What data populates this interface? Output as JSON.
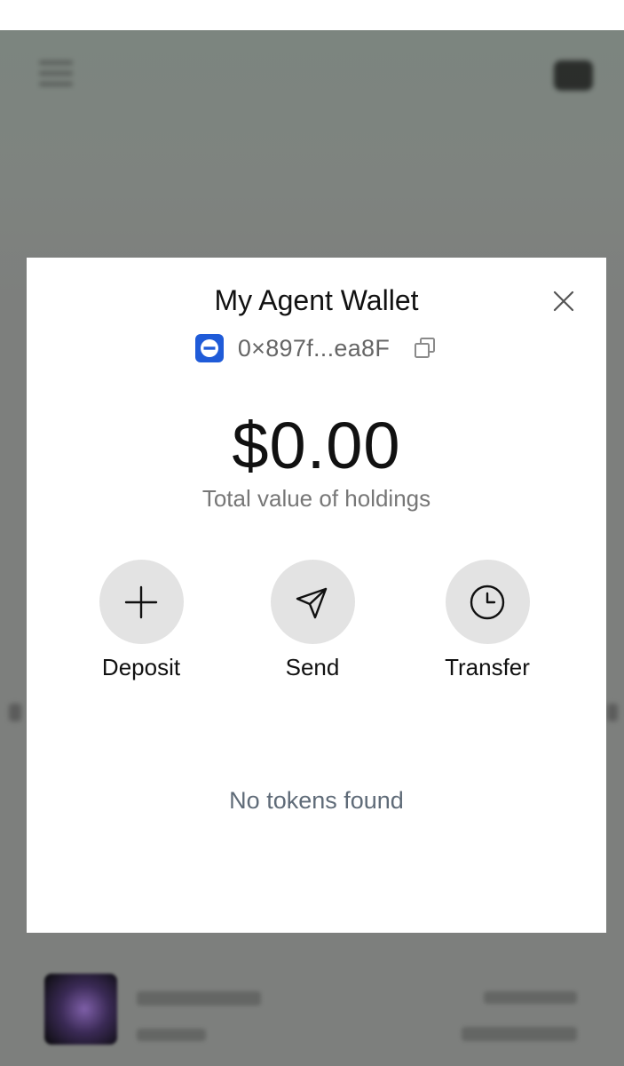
{
  "wallet_modal": {
    "title": "My Agent Wallet",
    "address": "0×897f...ea8F",
    "balance": "$0.00",
    "balance_label": "Total value of holdings",
    "actions": [
      {
        "label": "Deposit",
        "icon": "plus-icon"
      },
      {
        "label": "Send",
        "icon": "send-icon"
      },
      {
        "label": "Transfer",
        "icon": "clock-icon"
      }
    ],
    "empty_state": "No tokens found",
    "icons": {
      "close": "close-icon",
      "copy": "copy-icon",
      "chain": "chain-logo-icon"
    }
  },
  "colors": {
    "overlay_background": "#7d7f7d",
    "modal_background": "#ffffff",
    "action_circle": "#e3e3e3",
    "chain_blue": "#1f5bd8",
    "muted_text": "#777777",
    "empty_text": "#5f6b78"
  }
}
